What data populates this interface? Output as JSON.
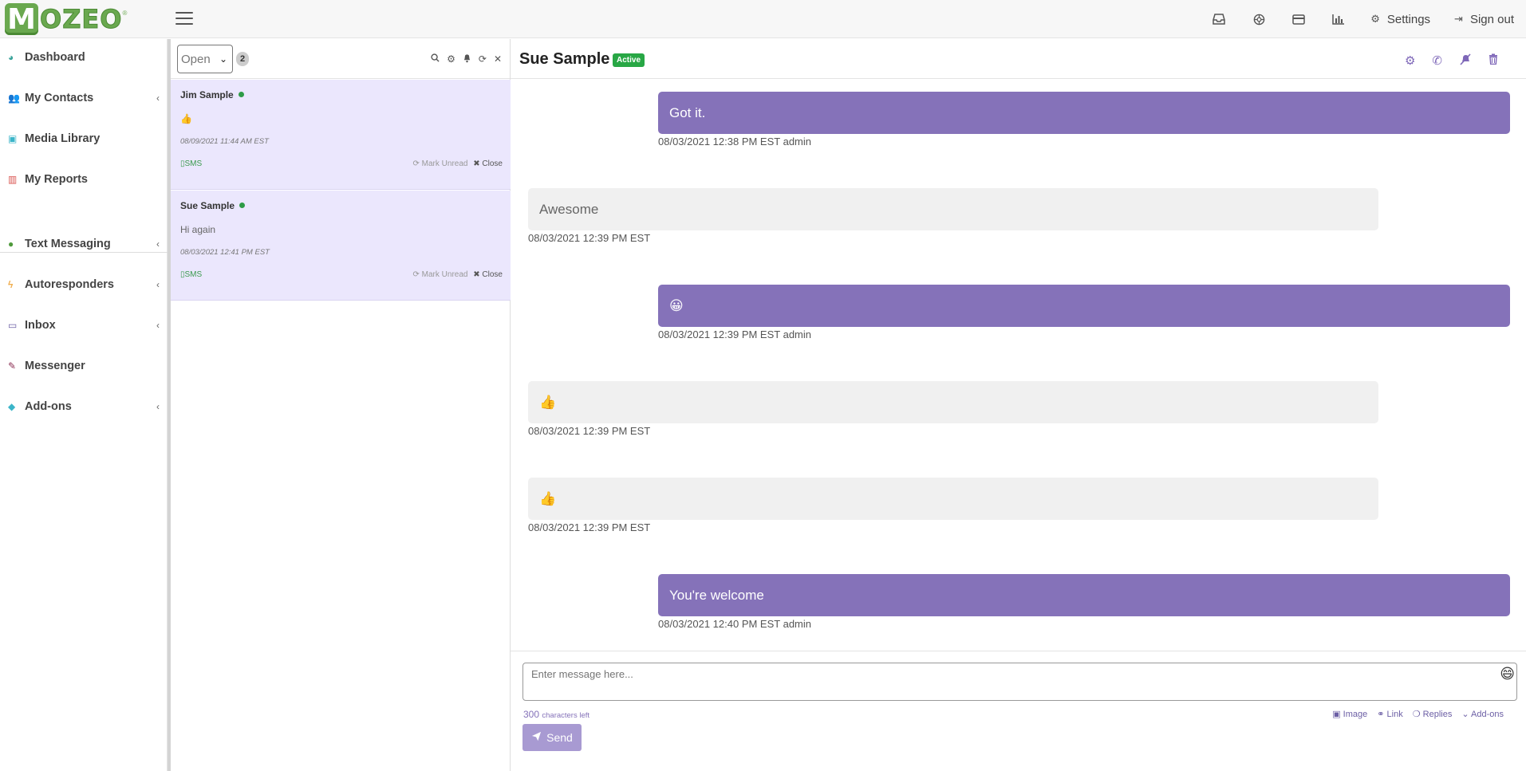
{
  "brand": {
    "logo_letter": "M",
    "logo_text": "OZEO",
    "tm": "®"
  },
  "topbar": {
    "icons": [
      "inbox-icon",
      "globe-icon",
      "credit-card-icon",
      "bar-chart-icon"
    ],
    "settings_label": "Settings",
    "signout_label": "Sign out"
  },
  "sidebar": {
    "items": [
      {
        "label": "Dashboard",
        "icon": "dashboard-icon"
      },
      {
        "label": "My Contacts",
        "icon": "users-icon"
      },
      {
        "label": "Media Library",
        "icon": "image-icon"
      },
      {
        "label": "My Reports",
        "icon": "bar-chart-icon"
      },
      {
        "label": "Text Messaging",
        "icon": "comments-icon"
      },
      {
        "label": "Autoresponders",
        "icon": "bolt-icon"
      },
      {
        "label": "Inbox",
        "icon": "inbox-icon"
      },
      {
        "label": "Messenger",
        "icon": "plug-icon"
      },
      {
        "label": "Add-ons",
        "icon": "diamond-icon"
      }
    ]
  },
  "convlist": {
    "filter_value": "Open",
    "count": "2",
    "conversations": [
      {
        "name": "Jim Sample",
        "preview": "👍",
        "time": "08/09/2021 11:44 AM EST",
        "channel": "SMS",
        "mark_unread": "Mark Unread",
        "close": "Close"
      },
      {
        "name": "Sue Sample",
        "preview": "Hi again",
        "time": "08/03/2021 12:41 PM EST",
        "channel": "SMS",
        "mark_unread": "Mark Unread",
        "close": "Close"
      }
    ]
  },
  "chat": {
    "contact_name": "Sue Sample",
    "status_badge": "Active",
    "messages": [
      {
        "direction": "out",
        "text": "Got it.",
        "meta": "08/03/2021 12:38 PM EST admin"
      },
      {
        "direction": "in",
        "text": "Awesome",
        "meta": "08/03/2021 12:39 PM EST"
      },
      {
        "direction": "out",
        "text": "😀",
        "meta": "08/03/2021 12:39 PM EST admin"
      },
      {
        "direction": "in",
        "text": "👍",
        "meta": "08/03/2021 12:39 PM EST"
      },
      {
        "direction": "in",
        "text": "👍",
        "meta": "08/03/2021 12:39 PM EST"
      },
      {
        "direction": "out",
        "text": "You're welcome",
        "meta": "08/03/2021 12:40 PM EST admin"
      }
    ],
    "composer": {
      "placeholder": "Enter message here...",
      "chars_left": "300",
      "chars_left_label": "characters left",
      "image_label": "Image",
      "link_label": "Link",
      "replies_label": "Replies",
      "addons_label": "Add-ons",
      "send_label": "Send"
    }
  }
}
